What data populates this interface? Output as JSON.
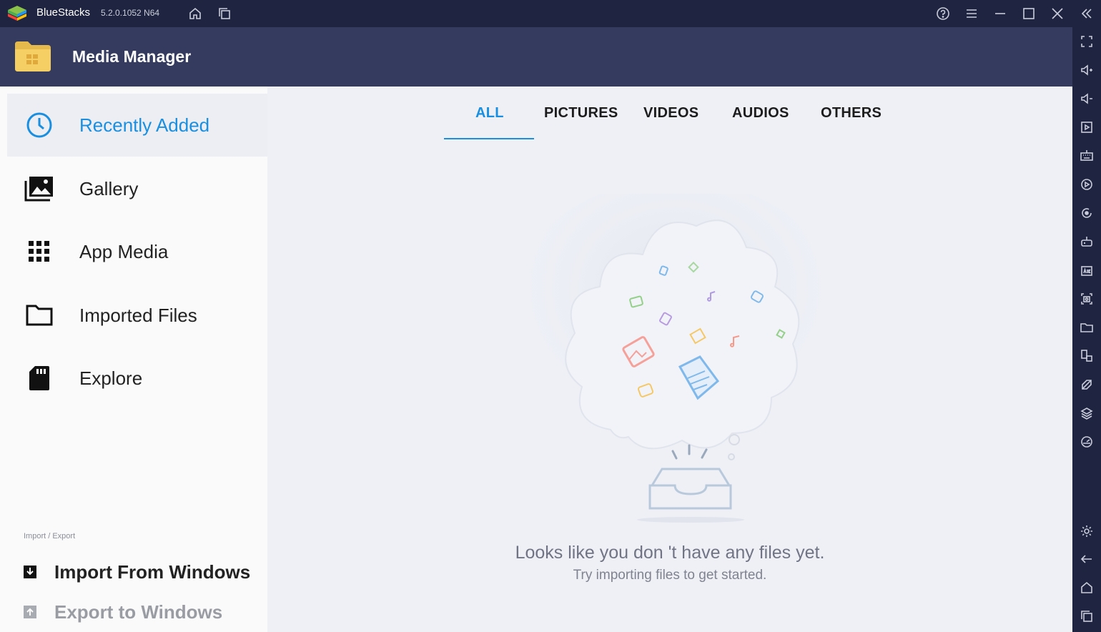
{
  "titlebar": {
    "app_name": "BlueStacks",
    "version": "5.2.0.1052 N64",
    "icons": [
      "home-icon",
      "multi-instance-icon",
      "help-icon",
      "menu-icon",
      "minimize-icon",
      "maximize-icon",
      "close-icon",
      "collapse-sidebar-icon"
    ]
  },
  "header": {
    "title": "Media Manager"
  },
  "nav": {
    "items": [
      {
        "label": "Recently Added",
        "icon": "clock-icon",
        "active": true
      },
      {
        "label": "Gallery",
        "icon": "gallery-icon",
        "active": false
      },
      {
        "label": "App Media",
        "icon": "grid-icon",
        "active": false
      },
      {
        "label": "Imported Files",
        "icon": "folder-icon",
        "active": false
      },
      {
        "label": "Explore",
        "icon": "sd-card-icon",
        "active": false
      }
    ],
    "section_label": "Import / Export",
    "import_label": "Import From Windows",
    "export_label": "Export to Windows"
  },
  "tabs": [
    {
      "label": "ALL",
      "active": true
    },
    {
      "label": "PICTURES",
      "active": false
    },
    {
      "label": "VIDEOS",
      "active": false
    },
    {
      "label": "AUDIOS",
      "active": false
    },
    {
      "label": "OTHERS",
      "active": false
    }
  ],
  "empty_state": {
    "title": "Looks like you don 't have any files yet.",
    "subtitle": "Try importing files to get started."
  },
  "colors": {
    "accent": "#1a8fe0",
    "titlebar_bg": "#1f2440",
    "header_bg": "#343b5e",
    "sidebar_bg": "#fafafa",
    "content_bg": "#eef0f6"
  },
  "right_sidebar_icons": [
    "fullscreen-icon",
    "volume-up-icon",
    "volume-down-icon",
    "media-player-icon",
    "keyboard-icon",
    "macro-icon",
    "rotate-icon",
    "game-controls-icon",
    "apk-icon",
    "screenshot-icon",
    "media-folder-icon",
    "multi-instance-sync-icon",
    "eco-mode-icon",
    "layers-icon",
    "performance-icon",
    "settings-icon",
    "back-icon",
    "android-home-icon",
    "recent-apps-icon"
  ]
}
